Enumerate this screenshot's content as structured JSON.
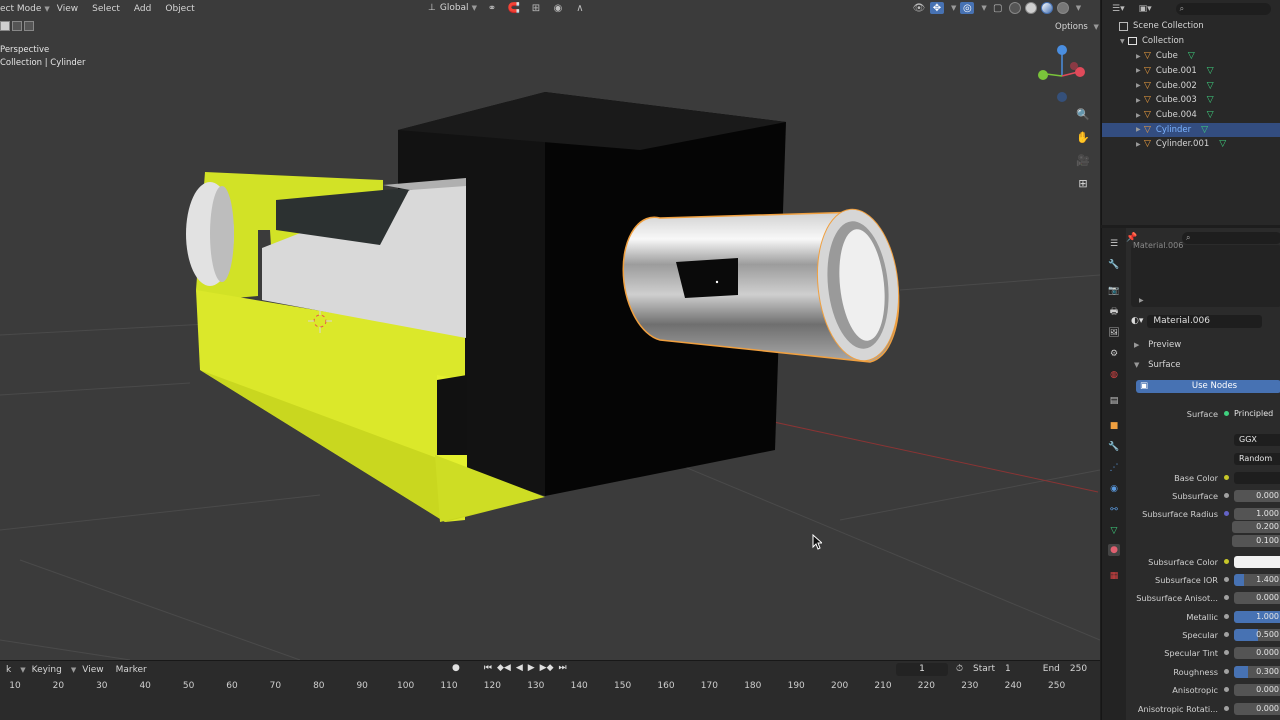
{
  "viewport_header": {
    "mode": "ect Mode",
    "menus": [
      "View",
      "Select",
      "Add",
      "Object"
    ],
    "orientation": "Global"
  },
  "viewport_info": {
    "line1": "Perspective",
    "line2": "Collection | Cylinder"
  },
  "options_label": "Options",
  "outliner": {
    "root": "Scene Collection",
    "collection": "Collection",
    "items": [
      {
        "name": "Cube",
        "selected": false
      },
      {
        "name": "Cube.001",
        "selected": false
      },
      {
        "name": "Cube.002",
        "selected": false
      },
      {
        "name": "Cube.003",
        "selected": false
      },
      {
        "name": "Cube.004",
        "selected": false
      },
      {
        "name": "Cylinder",
        "selected": true
      },
      {
        "name": "Cylinder.001",
        "selected": false
      }
    ]
  },
  "properties": {
    "slot_ghost": "Material.006",
    "material_name": "Material.006",
    "panels": {
      "preview": "Preview",
      "surface": "Surface"
    },
    "use_nodes": "Use Nodes",
    "surface": {
      "label": "Surface",
      "value": "Principled BSDF"
    },
    "distribution": "GGX",
    "subsurface_method": "Random Walk",
    "rows": [
      {
        "label": "Base Color",
        "value": "",
        "kind": "color-dark",
        "dot": "#c7c729",
        "fill": 0
      },
      {
        "label": "Subsurface",
        "value": "0.000",
        "kind": "num",
        "dot": "#a1a1a1",
        "fill": 0
      },
      {
        "label": "Subsurface Radius",
        "value": "1.000",
        "kind": "num",
        "dot": "#6363c7",
        "fill": 0
      },
      {
        "label": "Subsurface Color",
        "value": "",
        "kind": "color-white",
        "dot": "#c7c729",
        "fill": 0
      },
      {
        "label": "Subsurface IOR",
        "value": "1.400",
        "kind": "num",
        "dot": "#a1a1a1",
        "fill": 0.22
      },
      {
        "label": "Subsurface Anisot...",
        "value": "0.000",
        "kind": "num",
        "dot": "#a1a1a1",
        "fill": 0
      },
      {
        "label": "Metallic",
        "value": "1.000",
        "kind": "num",
        "dot": "#a1a1a1",
        "fill": 1.0
      },
      {
        "label": "Specular",
        "value": "0.500",
        "kind": "num",
        "dot": "#a1a1a1",
        "fill": 0.5
      },
      {
        "label": "Specular Tint",
        "value": "0.000",
        "kind": "num",
        "dot": "#a1a1a1",
        "fill": 0
      },
      {
        "label": "Roughness",
        "value": "0.300",
        "kind": "num",
        "dot": "#a1a1a1",
        "fill": 0.3
      },
      {
        "label": "Anisotropic",
        "value": "0.000",
        "kind": "num",
        "dot": "#a1a1a1",
        "fill": 0
      },
      {
        "label": "Anisotropic Rotati...",
        "value": "0.000",
        "kind": "num",
        "dot": "#a1a1a1",
        "fill": 0
      }
    ],
    "radius_extra": [
      "0.200",
      "0.100"
    ]
  },
  "timeline": {
    "menus": [
      "k",
      "Keying",
      "View",
      "Marker"
    ],
    "current_frame": "1",
    "start_label": "Start",
    "start_value": "1",
    "end_label": "End",
    "end_value": "250",
    "ruler": [
      "10",
      "20",
      "30",
      "40",
      "50",
      "60",
      "70",
      "80",
      "90",
      "100",
      "110",
      "120",
      "130",
      "140",
      "150",
      "160",
      "170",
      "180",
      "190",
      "200",
      "210",
      "220",
      "230",
      "240",
      "250"
    ]
  },
  "colors": {
    "accent": "#4772b3",
    "selected_outline": "#f0a040",
    "yellow_body": "#dbe82a",
    "mesh_icon": "#3fd17f"
  }
}
